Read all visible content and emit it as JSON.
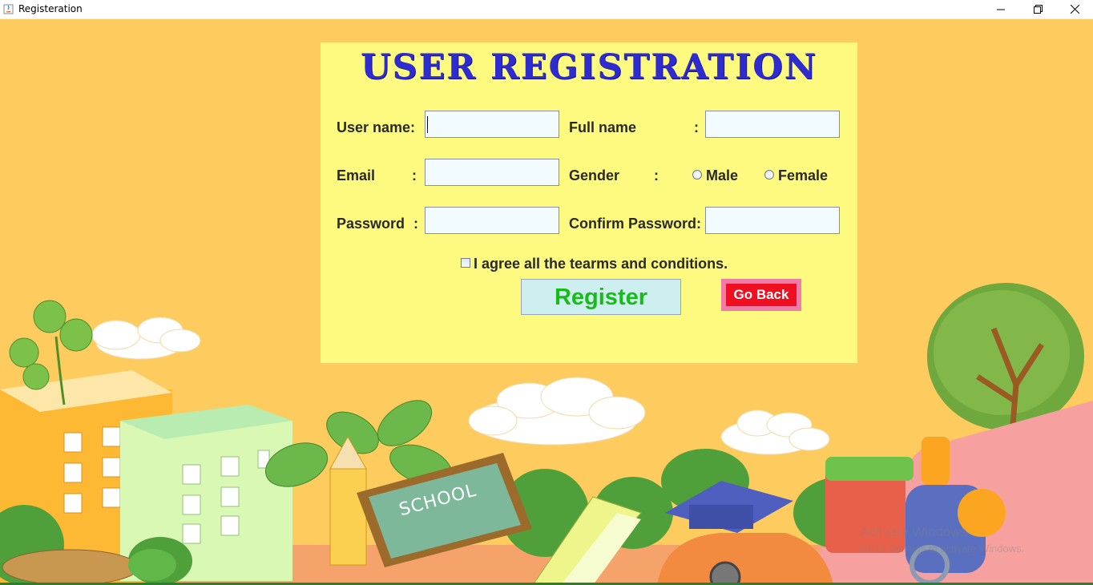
{
  "window": {
    "title": "Registeration",
    "minimize_icon": "minimize-icon",
    "restore_icon": "restore-icon",
    "close_icon": "close-icon"
  },
  "form": {
    "title": "USER REGISTRATION",
    "username_label": "User name:",
    "username_value": "",
    "fullname_label": "Full name",
    "fullname_value": "",
    "email_label": "Email",
    "email_value": "",
    "gender_label": "Gender",
    "gender_options": [
      "Male",
      "Female"
    ],
    "password_label": "Password",
    "password_value": "",
    "confirm_label": "Confirm Password:",
    "confirm_value": "",
    "colon": ":",
    "agree_label": "I agree all the tearms and conditions.",
    "register_label": "Register",
    "goback_label": "Go Back"
  },
  "background": {
    "sign_text": "SCHOOL",
    "watermark_line1": "Activate Windows",
    "watermark_line2": "Go to Settings to activate Windows."
  },
  "colors": {
    "background": "#fecb5e",
    "panel": "#fdfa7f",
    "title": "#2e2bd0",
    "register_text": "#18bb18",
    "goback_bg": "#ee1020"
  }
}
